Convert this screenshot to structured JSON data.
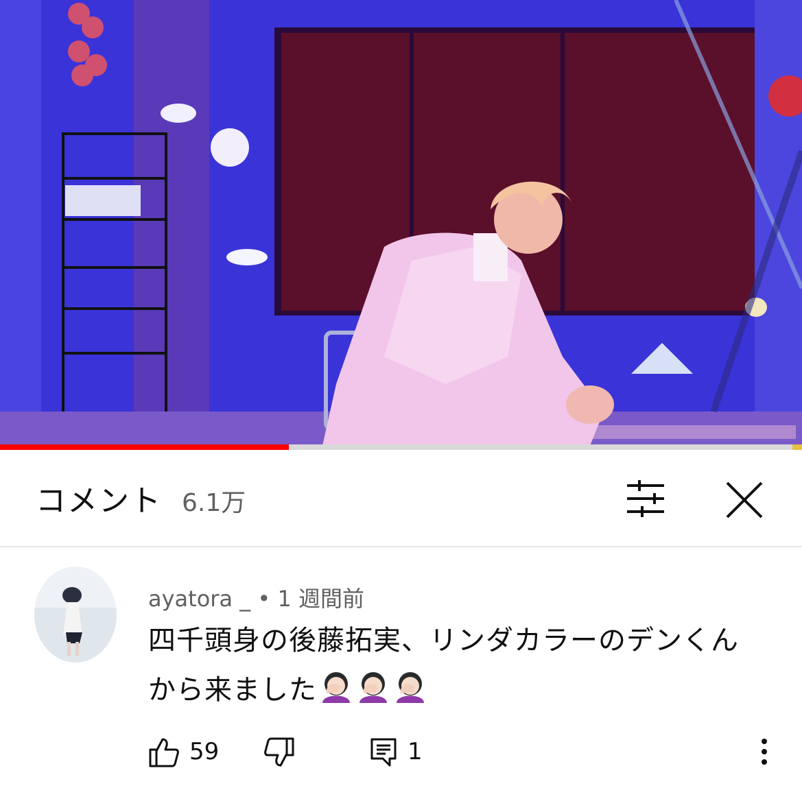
{
  "video": {
    "progress_fraction": 0.36
  },
  "comments_panel": {
    "title": "コメント",
    "count": "6.1万"
  },
  "comment": {
    "author": "ayatora _",
    "separator": "•",
    "time": "1 週間前",
    "text_line1": "四千頭身の後藤拓実、リンダカラーのデンくん",
    "text_line2": "から来ました",
    "emoji": [
      "face-palm-woman",
      "face-palm-woman",
      "face-palm-woman"
    ],
    "like_count": "59",
    "reply_count": "1"
  },
  "icons": {
    "filter": "filter-sliders-icon",
    "close": "close-icon",
    "like": "thumbs-up-icon",
    "dislike": "thumbs-down-icon",
    "reply": "reply-comment-icon",
    "more": "more-vert-icon"
  },
  "colors": {
    "progress": "#ff0000",
    "text_primary": "#0f0f0f",
    "text_secondary": "#606060"
  }
}
